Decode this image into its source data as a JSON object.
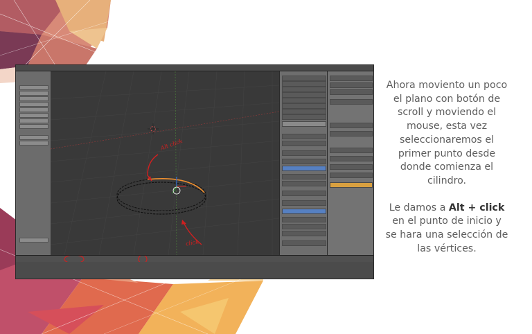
{
  "slide": {
    "paragraph1": "Ahora moviento un poco el plano con botón de scroll y moviendo el mouse, esta vez seleccionaremos el primer punto desde donde comienza el cilindro.",
    "paragraph2_prefix": "Le damos a ",
    "paragraph2_highlight": "Alt + click",
    "paragraph2_suffix": " en el punto de inicio y se hara una selección de las vértices."
  },
  "screenshot": {
    "annotation_top": "Alt click",
    "annotation_bottom": "click"
  }
}
